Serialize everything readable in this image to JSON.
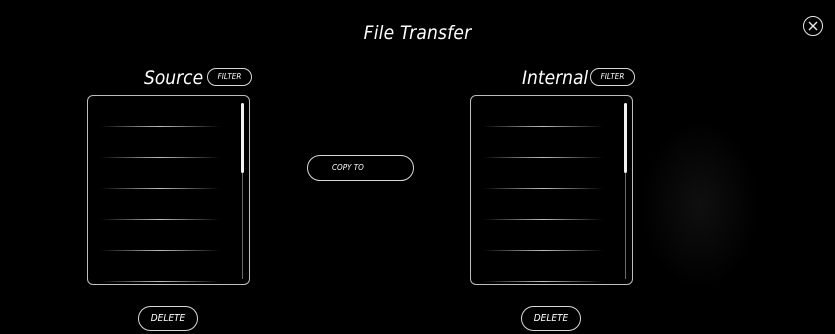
{
  "window": {
    "title": "File Transfer"
  },
  "source_panel": {
    "heading": "Source",
    "filter_label": "FILTER",
    "delete_label": "DELETE",
    "rows": [
      "",
      "",
      "",
      "",
      "",
      ""
    ]
  },
  "internal_panel": {
    "heading": "Internal",
    "filter_label": "FILTER",
    "delete_label": "DELETE",
    "rows": [
      "",
      "",
      "",
      "",
      "",
      ""
    ]
  },
  "actions": {
    "copy_label": "COPY TO"
  },
  "icons": {
    "close": "close-icon"
  },
  "colors": {
    "background": "#000000",
    "foreground": "#ffffff",
    "border": "#d8d8d8"
  }
}
